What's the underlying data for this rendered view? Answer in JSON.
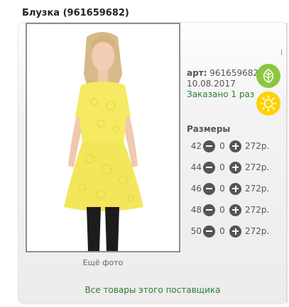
{
  "product": {
    "title": "Блузка (961659682)",
    "art_label": "арт:",
    "art_number": "961659682",
    "date": "10.08.2017",
    "ordered": "Заказано 1 раз",
    "more_photo": "Ещё фото",
    "supplier_link": "Все товары этого поставщика"
  },
  "sizes": {
    "title": "Размеры",
    "rows": [
      {
        "size": "42",
        "qty": "0",
        "price": "272р."
      },
      {
        "size": "44",
        "qty": "0",
        "price": "272р."
      },
      {
        "size": "46",
        "qty": "0",
        "price": "272р."
      },
      {
        "size": "48",
        "qty": "0",
        "price": "272р."
      },
      {
        "size": "50",
        "qty": "0",
        "price": "272р."
      }
    ]
  },
  "icons": {
    "badge_1": "leaf-icon",
    "badge_2": "sun-icon",
    "minus": "minus-circle-icon",
    "plus": "plus-circle-icon"
  },
  "colors": {
    "link_green": "#2e7d32",
    "leaf_green": "#8cc63f",
    "sun_yellow": "#ffd200",
    "blouse_yellow": "#f5ea62"
  }
}
